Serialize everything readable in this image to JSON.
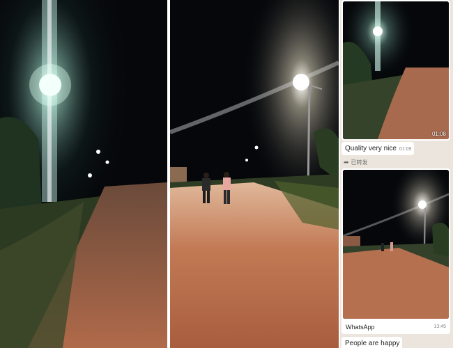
{
  "chat": {
    "messages": [
      {
        "type": "image",
        "timestamp": "01:08"
      },
      {
        "type": "text",
        "text": "Quality very nice",
        "timestamp": "01:09"
      },
      {
        "type": "forward",
        "label": "已转发"
      },
      {
        "type": "image",
        "caption": "WhatsApp",
        "timestamp": "13:45"
      },
      {
        "type": "text",
        "text": "People are happy"
      }
    ]
  },
  "colors": {
    "chat_background": "#ece5dd",
    "bubble": "#ffffff",
    "night_sky": "#06080a",
    "road": "#b86a4a"
  },
  "icons": {
    "forward": "forward-arrow-icon"
  }
}
